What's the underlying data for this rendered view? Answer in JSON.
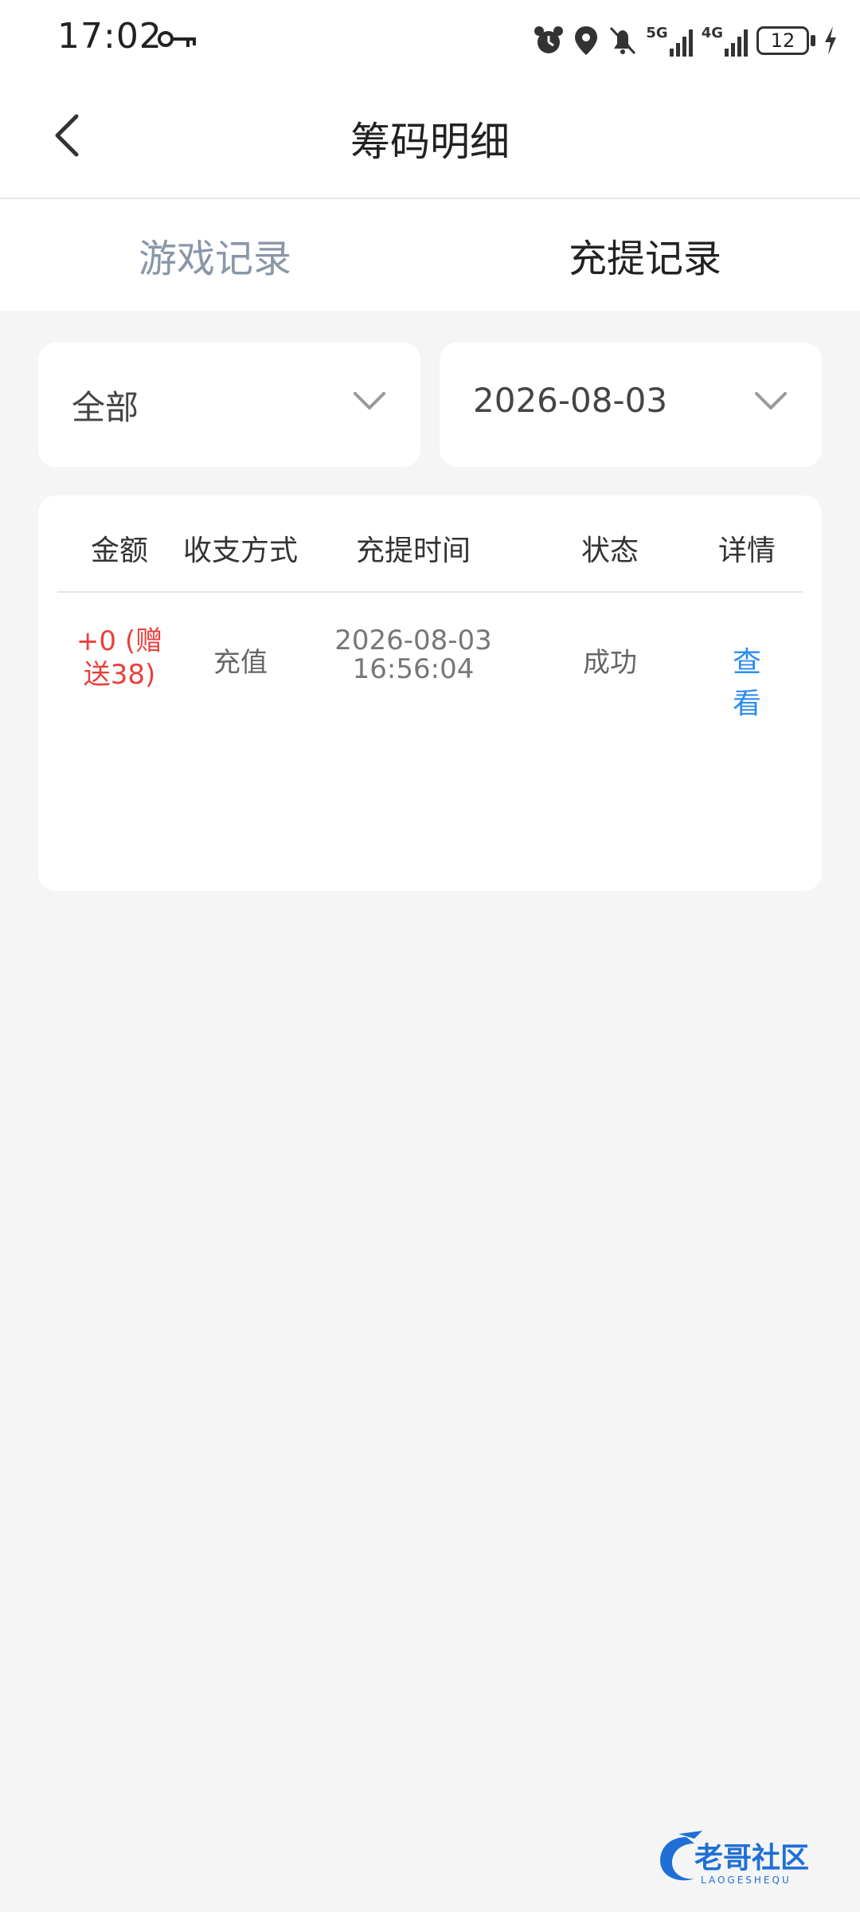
{
  "status_bar": {
    "time": "17:02",
    "signal_1": "5G",
    "signal_2": "4G",
    "battery": "12"
  },
  "header": {
    "title": "筹码明细"
  },
  "tabs": [
    {
      "label": "游戏记录",
      "active": false
    },
    {
      "label": "充提记录",
      "active": true
    }
  ],
  "filters": {
    "type_value": "全部",
    "date_value": "2026-08-03"
  },
  "table": {
    "columns": [
      "金额",
      "收支方式",
      "充提时间",
      "状态",
      "详情"
    ],
    "rows": [
      {
        "amount_line1": "+0 (赠",
        "amount_line2": "送38)",
        "method": "充值",
        "date": "2026-08-03",
        "time": "16:56:04",
        "status": "成功",
        "detail": "查看"
      }
    ]
  },
  "watermark": {
    "text": "老哥社区",
    "subtext": "LAOGESHEQU"
  },
  "colors": {
    "amount": "#e8413c",
    "link": "#2d8cf0",
    "inactive_tab": "#8a97a8"
  }
}
